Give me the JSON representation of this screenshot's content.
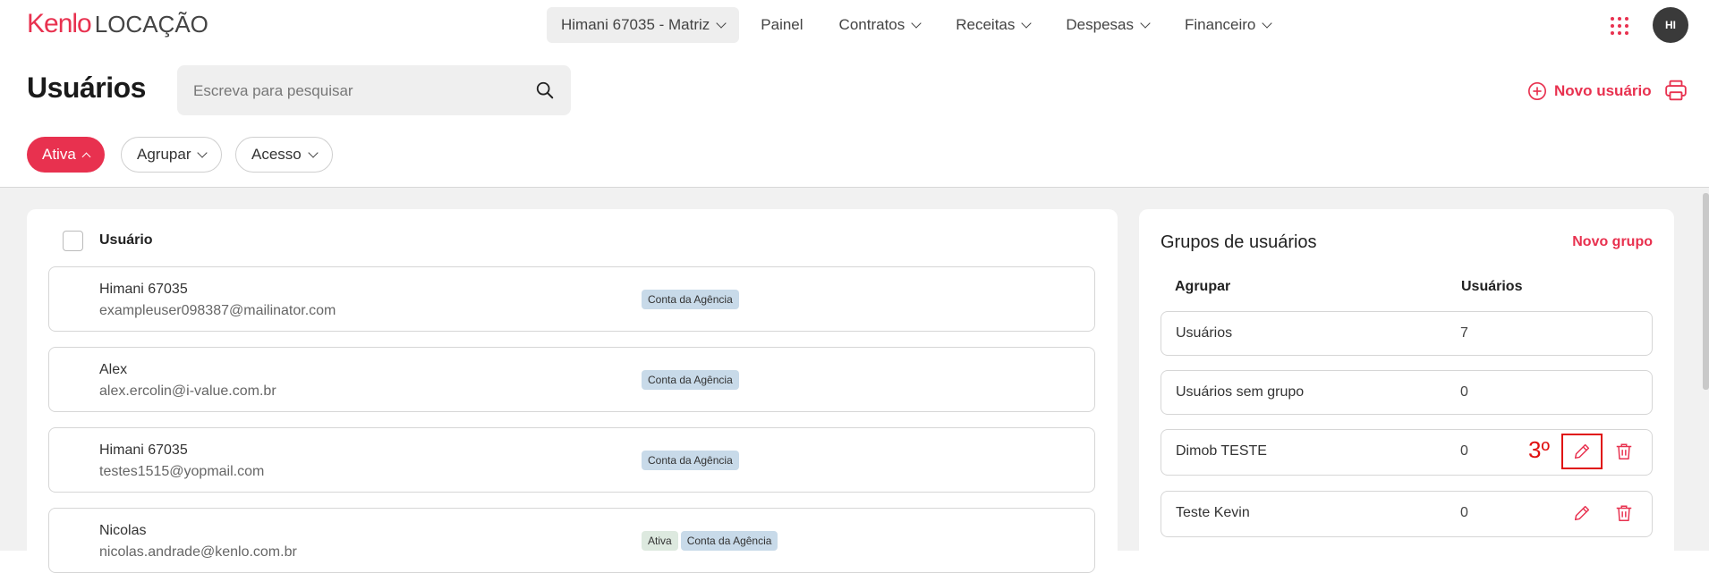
{
  "brand": {
    "name": "Kenlo",
    "product": "LOCAÇÃO"
  },
  "nav": {
    "agency": "Himani 67035 - Matriz",
    "items": [
      {
        "label": "Painel",
        "dropdown": false
      },
      {
        "label": "Contratos",
        "dropdown": true
      },
      {
        "label": "Receitas",
        "dropdown": true
      },
      {
        "label": "Despesas",
        "dropdown": true
      },
      {
        "label": "Financeiro",
        "dropdown": true
      }
    ],
    "avatar_initials": "HI"
  },
  "page": {
    "title": "Usuários",
    "search_placeholder": "Escreva para pesquisar",
    "new_user_label": "Novo usuário"
  },
  "filters": {
    "active_label": "Ativa",
    "group_label": "Agrupar",
    "access_label": "Acesso"
  },
  "users_panel": {
    "header": "Usuário",
    "rows": [
      {
        "name": "Himani 67035",
        "email": "exampleuser098387@mailinator.com",
        "badges": [
          "Conta da Agência"
        ]
      },
      {
        "name": "Alex",
        "email": "alex.ercolin@i-value.com.br",
        "badges": [
          "Conta da Agência"
        ]
      },
      {
        "name": "Himani 67035",
        "email": "testes1515@yopmail.com",
        "badges": [
          "Conta da Agência"
        ]
      },
      {
        "name": "Nicolas",
        "email": "nicolas.andrade@kenlo.com.br",
        "badges": [
          "Ativa",
          "Conta da Agência"
        ]
      }
    ]
  },
  "groups_panel": {
    "title": "Grupos de usuários",
    "new_group_label": "Novo grupo",
    "col_group": "Agrupar",
    "col_users": "Usuários",
    "rows": [
      {
        "name": "Usuários",
        "count": "7"
      },
      {
        "name": "Usuários sem grupo",
        "count": "0"
      },
      {
        "name": "Dimob TESTE",
        "count": "0"
      },
      {
        "name": "Teste Kevin",
        "count": "0"
      }
    ],
    "annotation": "3º"
  },
  "colors": {
    "accent": "#e8314f",
    "annotation": "#e01010",
    "badge_blue": "#c8dae9",
    "badge_green": "#dde9df"
  }
}
